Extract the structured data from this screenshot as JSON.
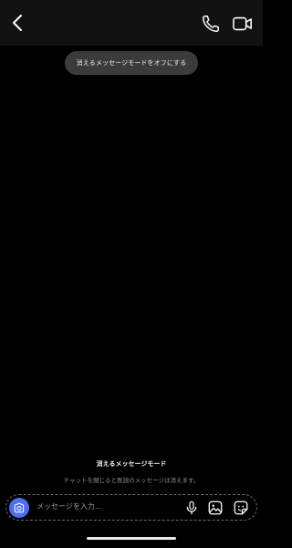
{
  "header": {
    "back_icon": "chevron-left-icon",
    "call_icon": "phone-icon",
    "video_icon": "video-camera-icon"
  },
  "banner": {
    "turn_off_label": "消えるメッセージモードをオフにする"
  },
  "disappearing_mode": {
    "title": "消えるメッセージモード",
    "subtitle": "チャットを閉じると既読のメッセージは消えます。"
  },
  "composer": {
    "placeholder": "メッセージを入力...",
    "camera_icon": "camera-icon",
    "mic_icon": "microphone-icon",
    "image_icon": "image-icon",
    "sticker_icon": "sticker-icon",
    "accent": "#4b6ef5"
  },
  "colors": {
    "background": "#000000",
    "header": "#121212",
    "pill": "#3b3b3b"
  }
}
